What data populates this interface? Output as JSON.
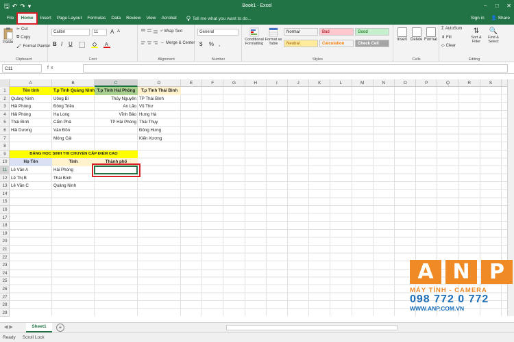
{
  "window": {
    "title": "Book1 - Excel",
    "controls": [
      "−",
      "□",
      "✕"
    ]
  },
  "qat": {
    "save": "🖫",
    "undo": "↶",
    "redo": "↷",
    "customize": "▾"
  },
  "tabs": [
    "File",
    "Home",
    "Insert",
    "Page Layout",
    "Formulas",
    "Data",
    "Review",
    "View",
    "Acrobat"
  ],
  "tell_me": "Tell me what you want to do...",
  "account": {
    "sign_in": "Sign in",
    "share": "Share"
  },
  "ribbon": {
    "clipboard": {
      "label": "Clipboard",
      "paste": "Paste",
      "cut": "Cut",
      "copy": "Copy",
      "painter": "Format Painter"
    },
    "font": {
      "label": "Font",
      "name": "Calibri",
      "size": "11",
      "bold": "B",
      "italic": "I",
      "underline": "U",
      "grow": "A",
      "shrink": "A"
    },
    "alignment": {
      "label": "Alignment",
      "wrap": "Wrap Text",
      "merge": "Merge & Center"
    },
    "number": {
      "label": "Number",
      "format": "General",
      "currency": "$",
      "percent": "%",
      "comma": ","
    },
    "styles": {
      "label": "Styles",
      "conditional": "Conditional Formatting",
      "format_table": "Format as Table",
      "cells": [
        {
          "name": "Normal",
          "bg": "#ffffff",
          "fg": "#000000"
        },
        {
          "name": "Bad",
          "bg": "#ffc7ce",
          "fg": "#9c0006"
        },
        {
          "name": "Good",
          "bg": "#c6efce",
          "fg": "#006100"
        },
        {
          "name": "Neutral",
          "bg": "#ffeb9c",
          "fg": "#9c5700"
        },
        {
          "name": "Calculation",
          "bg": "#f2f2f2",
          "fg": "#fa7d00"
        },
        {
          "name": "Check Cell",
          "bg": "#a5a5a5",
          "fg": "#ffffff"
        }
      ]
    },
    "cells": {
      "label": "Cells",
      "insert": "Insert",
      "delete": "Delete",
      "format": "Format"
    },
    "editing": {
      "label": "Editing",
      "autosum": "AutoSum",
      "fill": "Fill",
      "clear": "Clear",
      "sort": "Sort & Filter",
      "find": "Find & Select"
    }
  },
  "formula_bar": {
    "name_box": "C11",
    "fx": "fx",
    "value": ""
  },
  "columns": [
    "A",
    "B",
    "C",
    "D",
    "E",
    "F",
    "G",
    "H",
    "I",
    "J",
    "K",
    "L",
    "M",
    "N",
    "O",
    "P",
    "Q",
    "R",
    "S"
  ],
  "rows": [
    "1",
    "2",
    "3",
    "4",
    "5",
    "6",
    "7",
    "8",
    "9",
    "10",
    "11",
    "12",
    "13",
    "14",
    "15",
    "16",
    "17",
    "18",
    "19",
    "20",
    "21",
    "22",
    "23",
    "24",
    "25",
    "26",
    "27",
    "28",
    "29"
  ],
  "selected": {
    "column": "C",
    "row": "11"
  },
  "cells": {
    "A1": "Tên tỉnh",
    "B1": "T.p Tỉnh Quảng Ninh",
    "C1": "T.p Tỉnh Hải Phòng",
    "D1": "T.p Tỉnh Thái Bình",
    "A2": "Quảng Ninh",
    "B2": "Uông Bí",
    "C2": "Thủy Nguyên",
    "D2": "TP Thái Bình",
    "A3": "Hải Phòng",
    "B3": "Đông Triều",
    "C3": "An Lão",
    "D3": "Vũ Thư",
    "A4": "Hải Phòng",
    "B4": "Hạ Long",
    "C4": "Vĩnh Bảo",
    "D4": "Hưng Hà",
    "A5": "Thái Bình",
    "B5": "Cẩm Phả",
    "C5": "TP Hải Phòng",
    "D5": "Thái Thụy",
    "A6": "Hải Dương",
    "B6": "Vân Đồn",
    "D6": "Đông Hưng",
    "B7": "Móng Cái",
    "D7": "Kiến Xương",
    "A9": "BẢNG HỌC SINH THI CHUYỂN CẤP ĐIỂM CAO",
    "A10": "Họ Tên",
    "B10": "Tỉnh",
    "C10": "Thành phố",
    "A11": "Lê Văn A",
    "B11": "Hải Phòng",
    "A12": "Lê Thị B",
    "B12": "Thái Bình",
    "A13": "Lê Văn C",
    "B13": "Quảng Ninh"
  },
  "fills": {
    "header_yellow": "#ffff00",
    "header_green": "#a9d08e",
    "header_light": "#fff2cc",
    "header_blue": "#d9e1f2",
    "accent": "#217346",
    "highlight": "#d81f26"
  },
  "sheet": {
    "name": "Sheet1",
    "add": "+",
    "nav": "◀ ▶"
  },
  "status": {
    "ready": "Ready",
    "scroll": "Scroll Lock"
  },
  "watermark": {
    "letters": [
      "A",
      "N",
      "P"
    ],
    "line1": "MÁY TÍNH - CAMERA",
    "line2": "098 772 0 772",
    "line3": "WWW.ANP.COM.VN"
  }
}
